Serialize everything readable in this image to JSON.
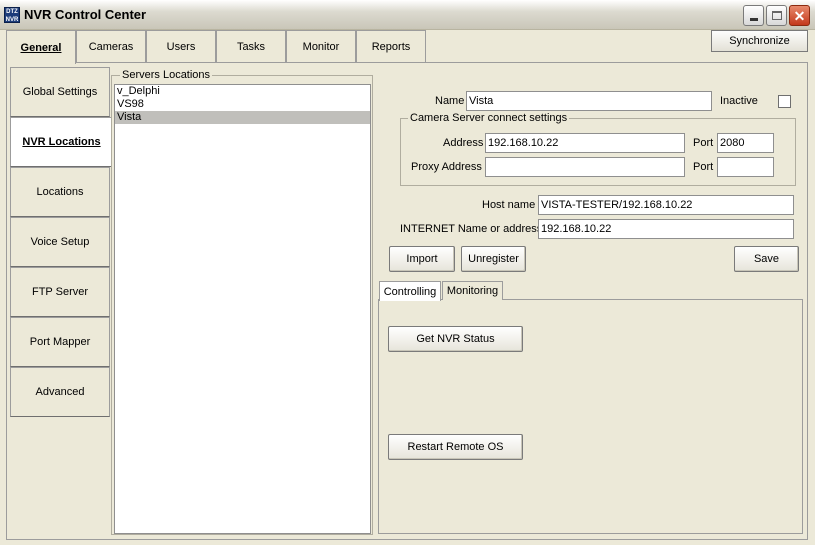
{
  "window": {
    "title": "NVR Control Center",
    "icon_text": "DTZ NVR",
    "controls": {
      "minimize": "minimize-icon",
      "maximize": "maximize-icon",
      "close": "close-icon"
    }
  },
  "top_tabs": [
    {
      "label": "General",
      "active": true
    },
    {
      "label": "Cameras"
    },
    {
      "label": "Users"
    },
    {
      "label": "Tasks"
    },
    {
      "label": "Monitor"
    },
    {
      "label": "Reports"
    }
  ],
  "sync_button": "Synchronize",
  "side_tabs": [
    {
      "label": "Global Settings"
    },
    {
      "label": "NVR Locations",
      "active": true
    },
    {
      "label": "Locations"
    },
    {
      "label": "Voice Setup"
    },
    {
      "label": "FTP Server"
    },
    {
      "label": "Port Mapper"
    },
    {
      "label": "Advanced"
    }
  ],
  "servers": {
    "group_label": "Servers Locations",
    "items": [
      "v_Delphi",
      "VS98",
      "Vista"
    ],
    "selected": "Vista"
  },
  "form": {
    "name_label": "Name",
    "name_value": "Vista",
    "inactive_label": "Inactive",
    "inactive_checked": false,
    "camera_group_label": "Camera Server connect settings",
    "address_label": "Address",
    "address_value": "192.168.10.22",
    "port_label": "Port",
    "port_value": "2080",
    "proxy_label": "Proxy Address",
    "proxy_value": "",
    "proxy_port_label": "Port",
    "proxy_port_value": "",
    "host_label": "Host name",
    "host_value": "VISTA-TESTER/192.168.10.22",
    "internet_label": "INTERNET Name or address",
    "internet_value": "192.168.10.22"
  },
  "buttons": {
    "import": "Import",
    "unregister": "Unregister",
    "save": "Save"
  },
  "sub_tabs": [
    {
      "label": "Controlling",
      "active": true
    },
    {
      "label": "Monitoring"
    }
  ],
  "controlling": {
    "get_status": "Get NVR Status",
    "restart": "Restart Remote OS"
  }
}
